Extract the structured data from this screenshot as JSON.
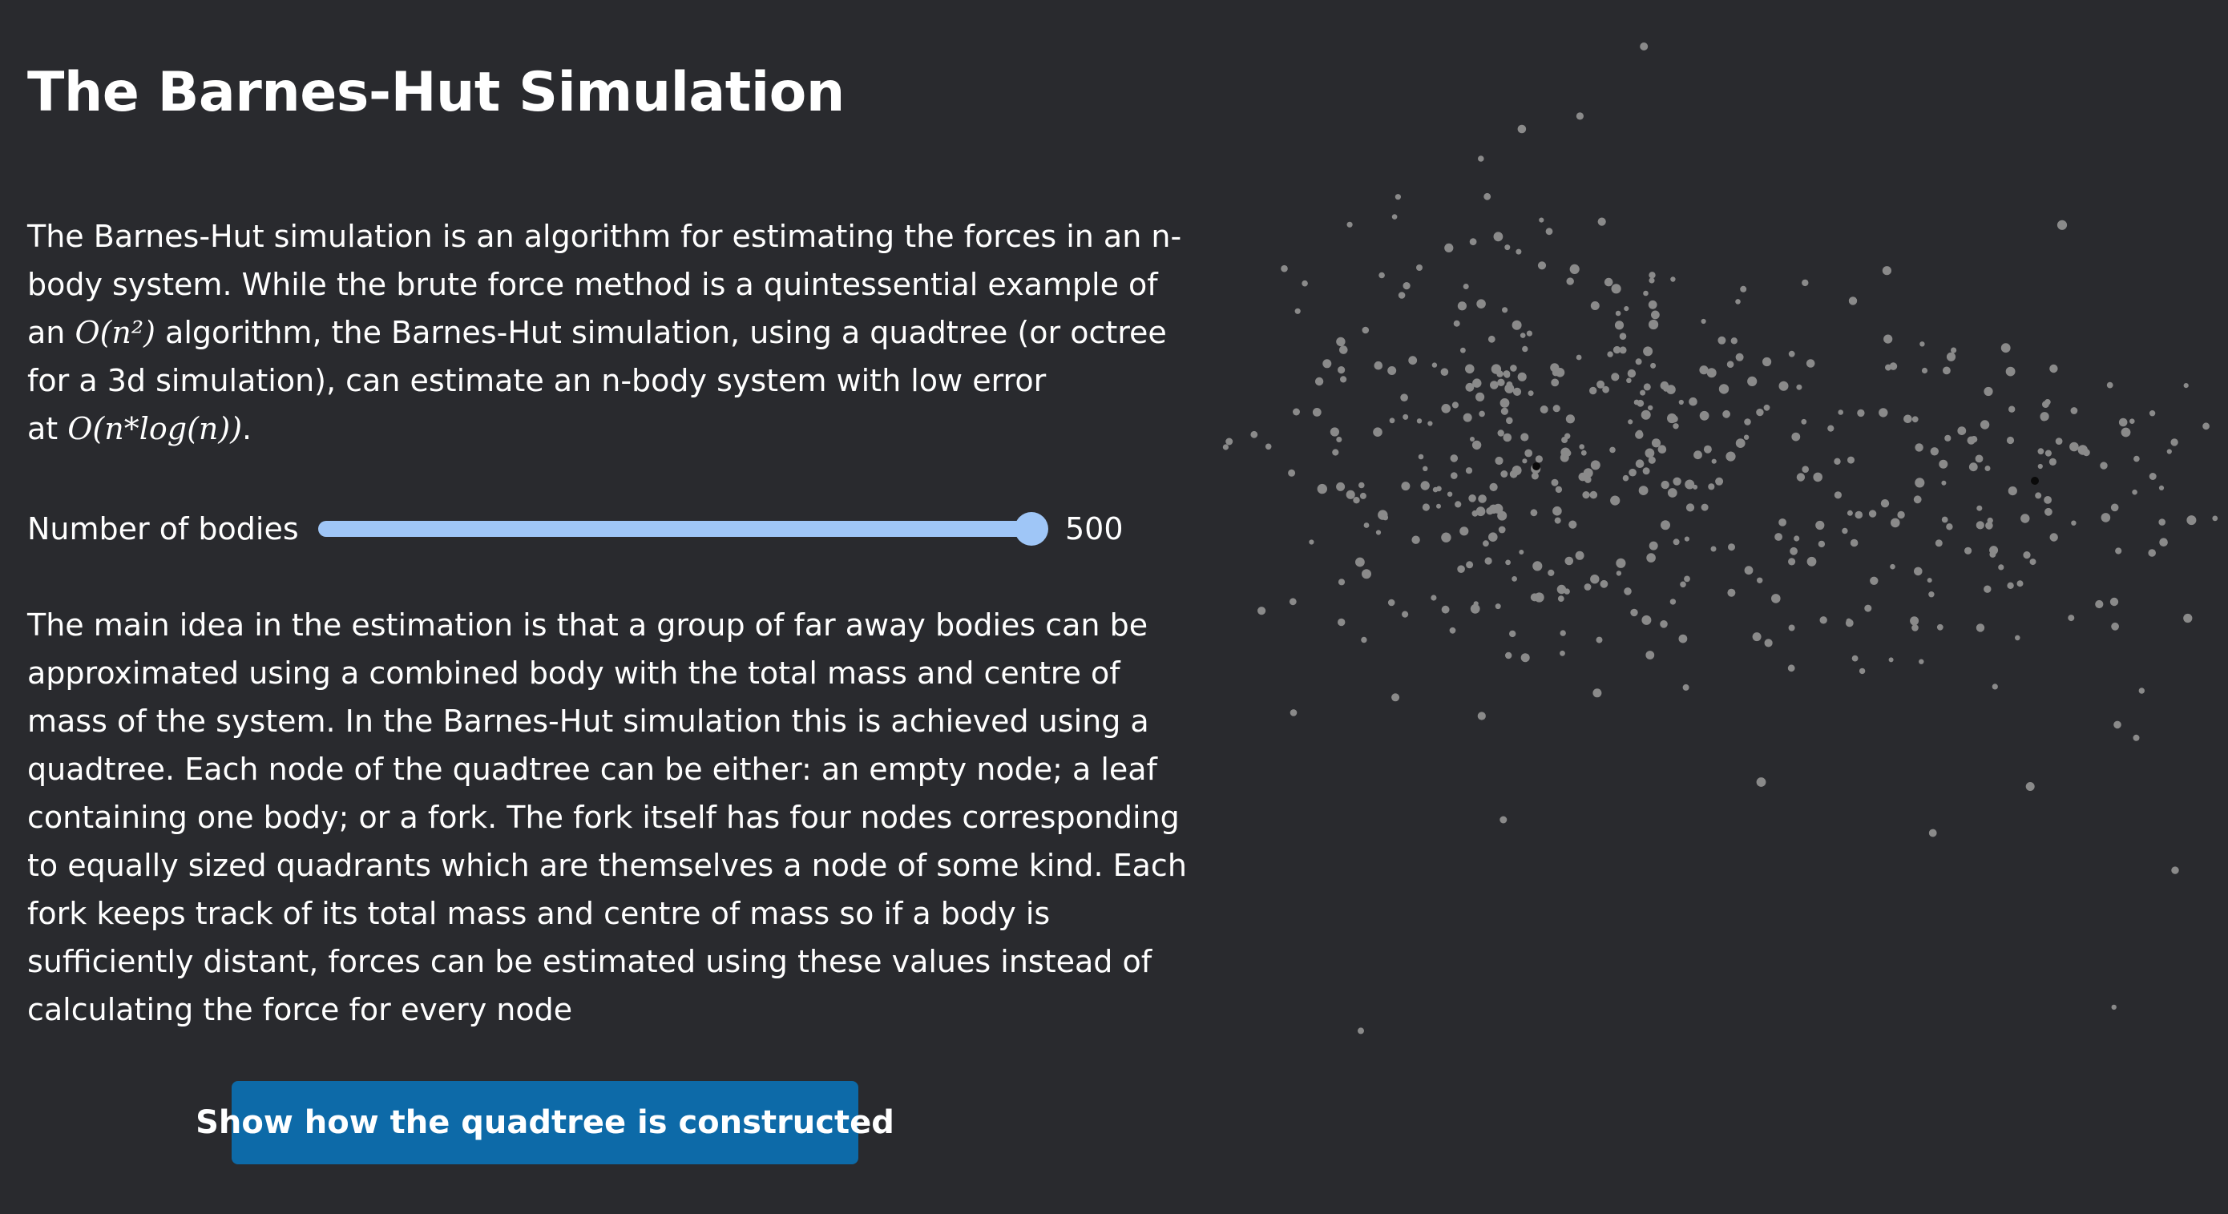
{
  "title": "The Barnes-Hut Simulation",
  "intro": {
    "l1": "The Barnes-Hut simulation is an algorithm for estimating the forces in an n-",
    "l2": "body system. While the brute force method is a quintessential example of",
    "l3_pre": "an ",
    "l3_math": "O(n²)",
    "l3_post": " algorithm, the Barnes-Hut simulation, using a quadtree (or octree",
    "l4": "for a 3d simulation), can estimate an n-body system with low error",
    "l5_pre": "at ",
    "l5_math": "O(n*log(n))",
    "l5_post": "."
  },
  "slider": {
    "label": "Number of bodies",
    "value": "500",
    "fraction": 1.0
  },
  "explanation": {
    "lines": [
      "The main idea in the estimation is that a group of far away bodies can be",
      "approximated using a combined body with the total mass and centre of",
      "mass of the system. In the Barnes-Hut simulation this is achieved using a",
      "quadtree. Each node of the quadtree can be either: an empty node; a leaf",
      "containing one body; or a fork. The fork itself has four nodes corresponding",
      "to equally sized quadrants which are themselves a node of some kind. Each",
      "fork keeps track of its total mass and centre of mass so if a body is",
      "sufficiently distant, forces can be estimated using these values instead of",
      "calculating the force for every node"
    ]
  },
  "button": {
    "label": "Show how the quadtree is constructed"
  },
  "colors": {
    "background": "#292a2e",
    "slider": "#9fc6f7",
    "button": "#0d6aa8",
    "particle": "#8a8a8a",
    "heavy_particle": "#0a0a0a"
  }
}
